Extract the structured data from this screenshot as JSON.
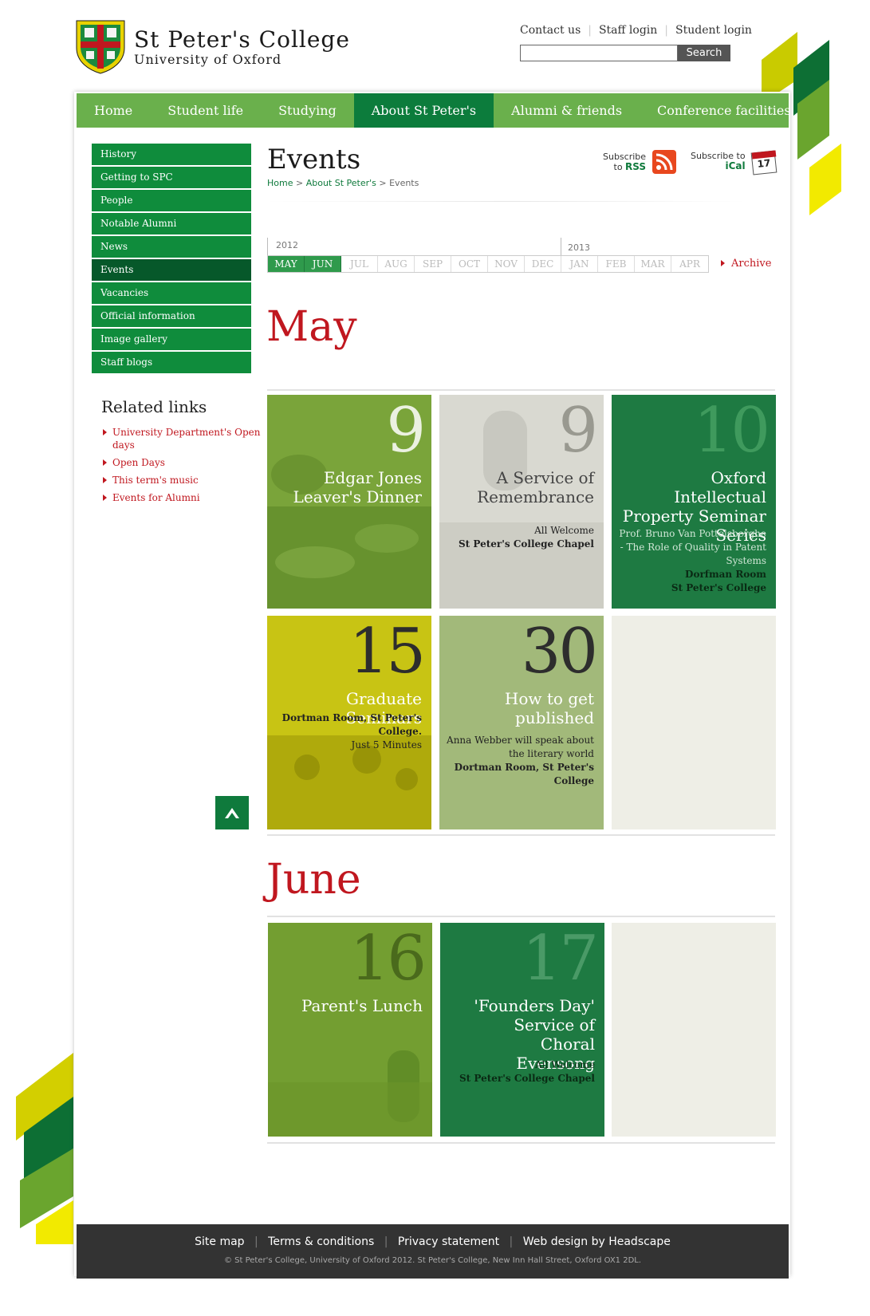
{
  "header": {
    "college_name_line1": "St Peter's College",
    "college_name_line2": "University of Oxford",
    "top_links": [
      "Contact us",
      "Staff login",
      "Student login"
    ],
    "search_button": "Search"
  },
  "nav": {
    "items": [
      "Home",
      "Student life",
      "Studying",
      "About St Peter's",
      "Alumni & friends",
      "Conference facilities"
    ],
    "active_index": 3
  },
  "sidebar": {
    "items": [
      "History",
      "Getting to SPC",
      "People",
      "Notable Alumni",
      "News",
      "Events",
      "Vacancies",
      "Official information",
      "Image gallery",
      "Staff blogs"
    ],
    "active_index": 5
  },
  "related": {
    "title": "Related links",
    "links": [
      "University Department's Open days",
      "Open Days",
      "This term's music",
      "Events for Alumni"
    ]
  },
  "page": {
    "title": "Events",
    "breadcrumb": [
      "Home",
      "About St Peter's",
      "Events"
    ],
    "subscribe_rss_line1": "Subscribe",
    "subscribe_rss_line2_prefix": "to",
    "subscribe_rss_line2": "RSS",
    "subscribe_ical_line1": "Subscribe to",
    "subscribe_ical_line2": "iCal",
    "ical_day": "17"
  },
  "calendar": {
    "year1": "2012",
    "year2": "2013",
    "months": [
      "MAY",
      "JUN",
      "JUL",
      "AUG",
      "SEP",
      "OCT",
      "NOV",
      "DEC",
      "JAN",
      "FEB",
      "MAR",
      "APR"
    ],
    "active_months": [
      "MAY",
      "JUN"
    ],
    "archive_label": "Archive"
  },
  "sections": [
    {
      "month": "May",
      "events": [
        {
          "day": "9",
          "title": "Edgar Jones Leaver's Dinner",
          "lines": []
        },
        {
          "day": "9",
          "title": "A Service of Remembrance",
          "lines": [
            "All Welcome",
            "St Peter's College Chapel"
          ]
        },
        {
          "day": "10",
          "title": "Oxford Intellectual Property Seminar Series",
          "lines": [
            "Prof. Bruno Van Pottelsberghe - The Role of Quality in Patent Systems",
            "Dorfman Room",
            "St Peter's College"
          ]
        },
        {
          "day": "15",
          "title": "Graduate Seminars",
          "lines": [
            "Dortman Room, St Peter's College.",
            "Just 5 Minutes"
          ]
        },
        {
          "day": "30",
          "title": "How to get published",
          "lines": [
            "Anna Webber will speak about the literary world",
            "Dortman Room, St Peter's College"
          ]
        }
      ]
    },
    {
      "month": "June",
      "events": [
        {
          "day": "16",
          "title": "Parent's Lunch",
          "lines": []
        },
        {
          "day": "17",
          "title": "'Founders Day' Service of Choral Evensong",
          "lines": [
            "All Welcome",
            "St Peter's College Chapel"
          ]
        }
      ]
    }
  ],
  "footer": {
    "links": [
      "Site map",
      "Terms & conditions",
      "Privacy statement",
      "Web design by Headscape"
    ],
    "copyright": "© St Peter's College, University of Oxford 2012. St Peter's College, New Inn Hall Street, Oxford OX1 2DL."
  },
  "colors": {
    "nav_green": "#6ab04c",
    "dark_green": "#0c7c3c",
    "red": "#c0171f",
    "yellow": "#e5e500"
  }
}
